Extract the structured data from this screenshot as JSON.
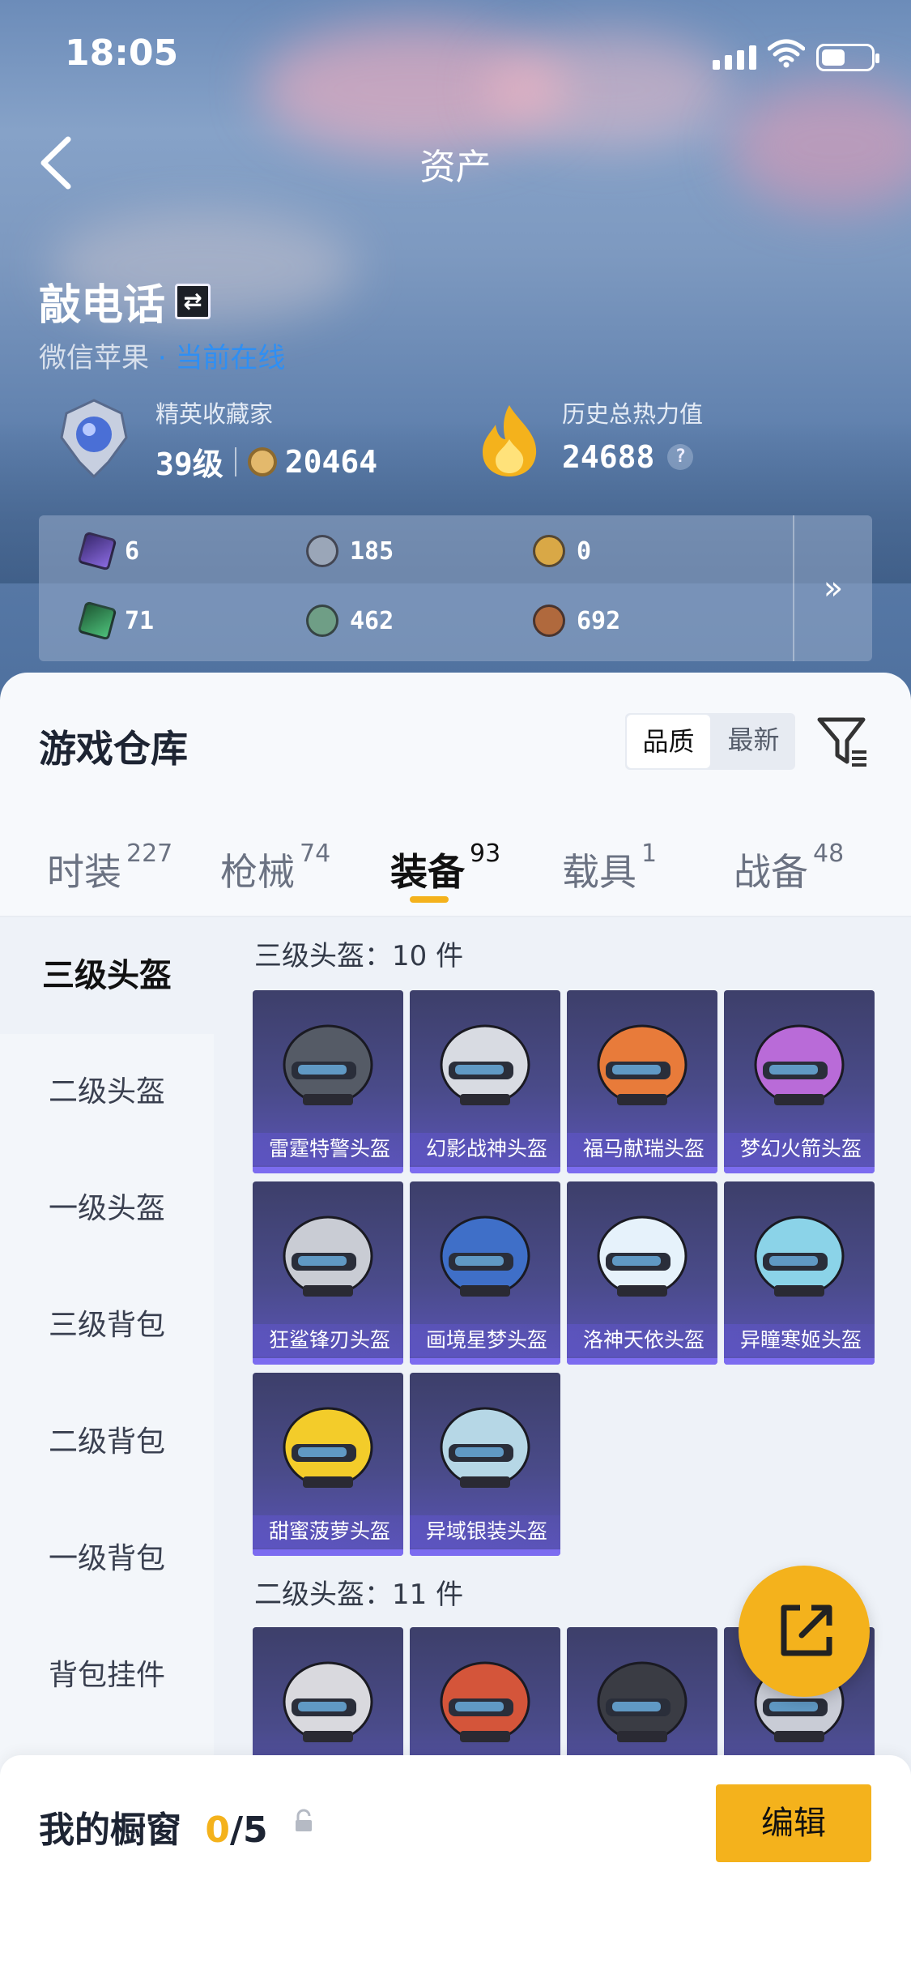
{
  "status_bar": {
    "time": "18:05"
  },
  "header": {
    "title": "资产"
  },
  "profile": {
    "name": "敲电话",
    "platform": "微信苹果",
    "separator": "·",
    "online_status": "当前在线",
    "collector": {
      "label": "精英收藏家",
      "level": "39级",
      "points": "20464"
    },
    "heat": {
      "label": "历史总热力值",
      "value": "24688",
      "help": "?"
    }
  },
  "currencies": [
    {
      "icon": "purple-crystal-icon",
      "value": "6"
    },
    {
      "icon": "silver-coin-icon",
      "value": "185"
    },
    {
      "icon": "gold-coin-icon",
      "value": "0"
    },
    {
      "icon": "green-card-icon",
      "value": "71"
    },
    {
      "icon": "green-coin-icon",
      "value": "462"
    },
    {
      "icon": "bronze-coin-icon",
      "value": "692"
    }
  ],
  "currency_more": "»",
  "warehouse": {
    "title": "游戏仓库",
    "sort": [
      "品质",
      "最新"
    ],
    "tabs": [
      {
        "label": "时装",
        "count": "227"
      },
      {
        "label": "枪械",
        "count": "74"
      },
      {
        "label": "装备",
        "count": "93"
      },
      {
        "label": "载具",
        "count": "1"
      },
      {
        "label": "战备",
        "count": "48"
      }
    ],
    "side_items": [
      "三级头盔",
      "二级头盔",
      "一级头盔",
      "三级背包",
      "二级背包",
      "一级背包",
      "背包挂件"
    ],
    "groups": [
      {
        "header": "三级头盔：10 件",
        "items": [
          "雷霆特警头盔",
          "幻影战神头盔",
          "福马献瑞头盔",
          "梦幻火箭头盔",
          "狂鲨锋刃头盔",
          "画境星梦头盔",
          "洛神天依头盔",
          "异瞳寒姬头盔",
          "甜蜜菠萝头盔",
          "异域银装头盔"
        ]
      },
      {
        "header": "二级头盔：11 件",
        "items": [
          "",
          "",
          "",
          ""
        ]
      }
    ]
  },
  "showcase": {
    "title": "我的橱窗",
    "current": "0",
    "total": "/5",
    "edit_label": "编辑"
  },
  "colors": {
    "accent": "#f4b21c",
    "online": "#2f8ff3",
    "card": "#4a4b8a"
  }
}
